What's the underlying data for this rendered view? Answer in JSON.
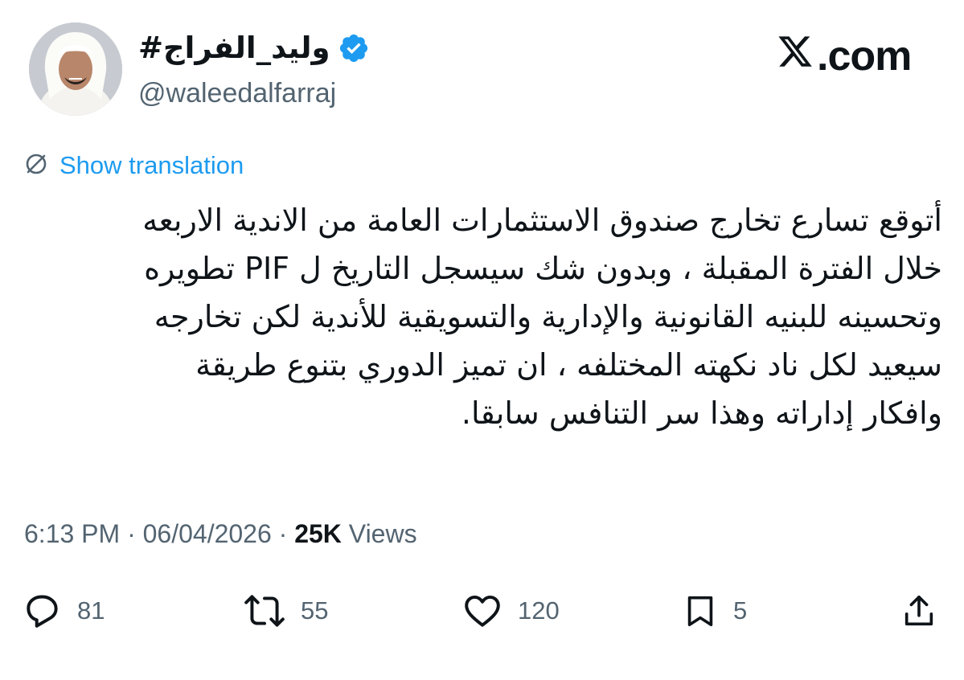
{
  "brand": {
    "dot": ".com"
  },
  "author": {
    "display_name": "#وليد_الفراج",
    "handle": "@waleedalfarraj",
    "verified": true
  },
  "translate": {
    "label": "Show translation"
  },
  "tweet": {
    "lines": [
      "أتوقع تسارع تخارج صندوق الاستثمارات العامة من الاندية الاربعه",
      "خلال الفترة المقبلة ، وبدون شك سيسجل التاريخ ل PIF تطويره",
      "وتحسينه للبنيه القانونية والإدارية والتسويقية للأندية لكن تخارجه",
      "سيعيد لكل ناد نكهته المختلفه ، ان تميز الدوري بتنوع طريقة",
      "وافكار إداراته وهذا سر التنافس سابقا."
    ]
  },
  "meta": {
    "time": "6:13 PM",
    "sep1": " · ",
    "date": "06/04/2026",
    "sep2": " · ",
    "views_count": "25K",
    "views_label": " Views"
  },
  "actions": {
    "replies": "81",
    "reposts": "55",
    "likes": "120",
    "bookmarks": "5"
  },
  "colors": {
    "accent": "#1d9bf0",
    "text": "#0f1419",
    "muted": "#536471"
  },
  "icons": [
    "verified-badge-icon",
    "x-logo-icon",
    "globe-translate-icon",
    "reply-icon",
    "repost-icon",
    "like-icon",
    "bookmark-icon",
    "share-icon"
  ]
}
